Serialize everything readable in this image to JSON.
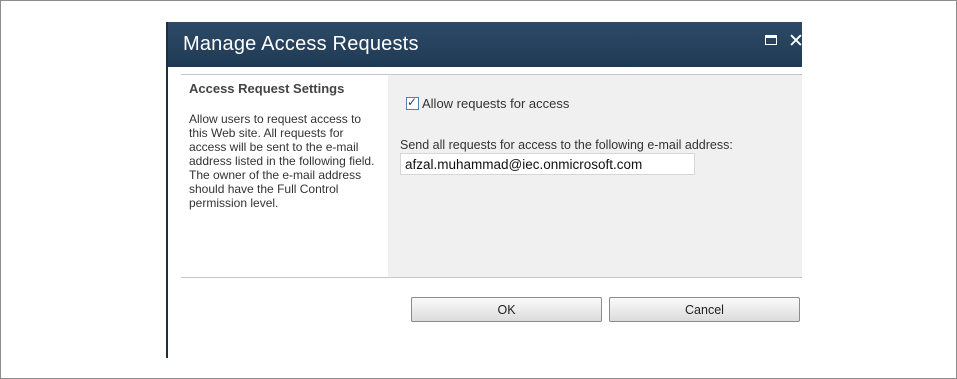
{
  "dialog": {
    "title": "Manage Access Requests"
  },
  "settings": {
    "section_title": "Access Request Settings",
    "description": "Allow users to request access to this Web site. All requests for access will be sent to the e-mail address listed in the following field. The owner of the e-mail address should have the Full Control permission level."
  },
  "form": {
    "allow_requests_label": "Allow requests for access",
    "allow_requests_checked": true,
    "email_label": "Send all requests for access to the following e-mail address:",
    "email_value": "afzal.muhammad@iec.onmicrosoft.com"
  },
  "buttons": {
    "ok_label": "OK",
    "cancel_label": "Cancel"
  },
  "icons": {
    "maximize": "maximize-icon",
    "close": "close-icon"
  }
}
